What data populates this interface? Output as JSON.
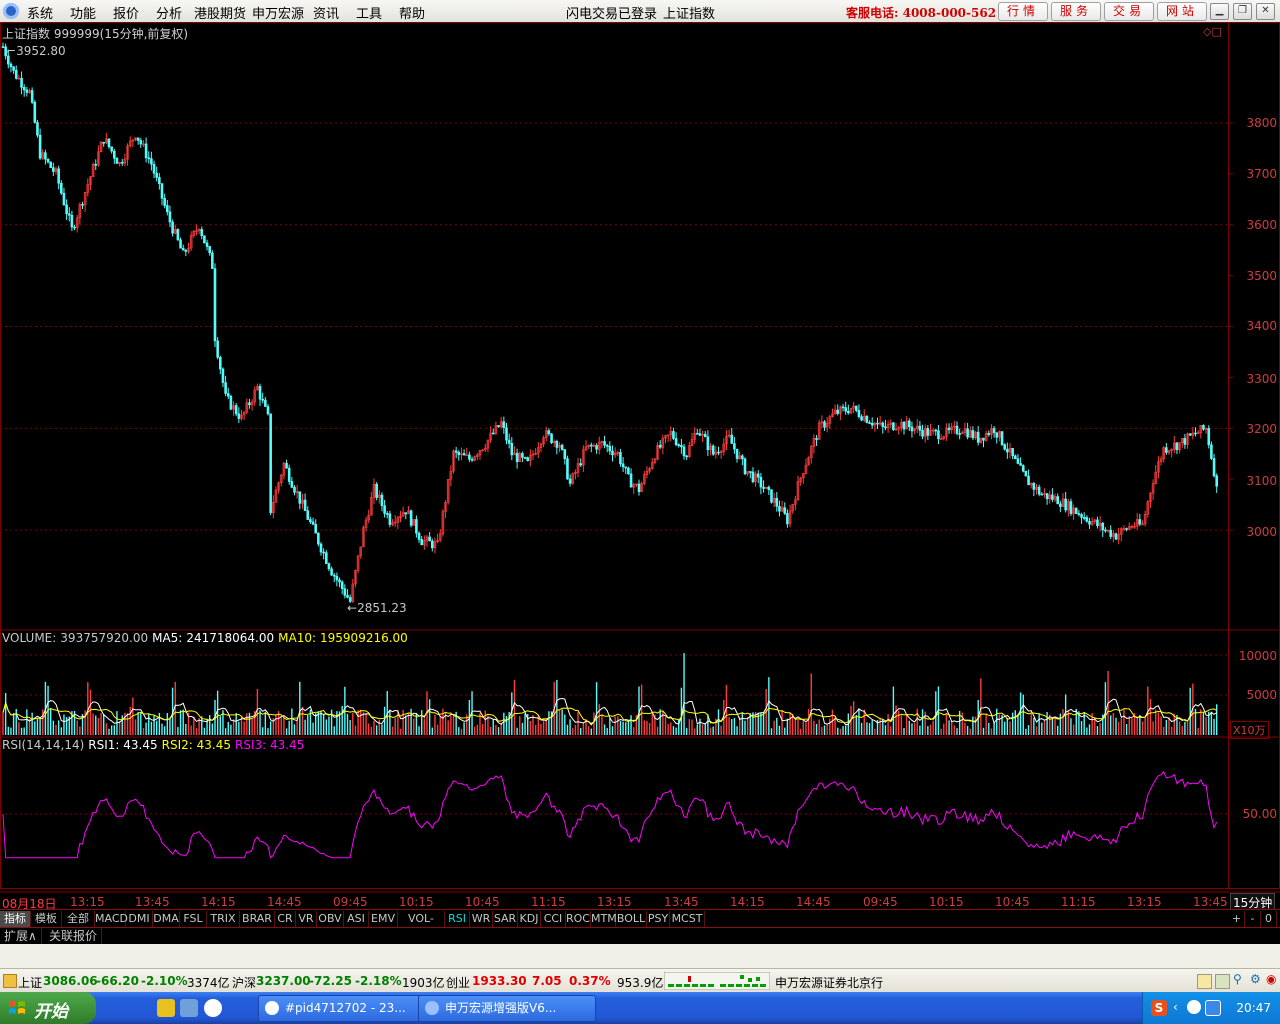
{
  "menubar": {
    "items": [
      "系统",
      "功能",
      "报价",
      "分析",
      "港股期货",
      "申万宏源",
      "资讯",
      "工具",
      "帮助"
    ],
    "status_login": "闪电交易已登录",
    "status_symbol": "上证指数",
    "hotline": "客服电话: 4008-000-562",
    "quick_buttons": [
      "行情",
      "服务",
      "交易",
      "网站"
    ]
  },
  "chart": {
    "title": "上证指数 999999(15分钟,前复权)",
    "high_label": "3952.80",
    "low_label": "2851.23",
    "price_axis": [
      "3800",
      "3700",
      "3600",
      "3500",
      "3400",
      "3300",
      "3200",
      "3100",
      "3000"
    ],
    "volume_axis": [
      "10000",
      "5000"
    ],
    "volume_unit": "X10万",
    "rsi_axis": [
      "50.00"
    ],
    "time_axis": [
      "08月18日",
      "13:15",
      "13:45",
      "14:15",
      "14:45",
      "09:45",
      "10:15",
      "10:45",
      "11:15",
      "13:15",
      "13:45",
      "14:15",
      "14:45",
      "09:45",
      "10:15",
      "10:45",
      "11:15",
      "13:15",
      "13:45"
    ],
    "period": "15分钟",
    "colors": {
      "up": "#ff3c3c",
      "down": "#54fcfc",
      "grid": "#800000",
      "ma5": "#ffffff",
      "ma10": "#ffff00",
      "rsi": "#ff00ff"
    }
  },
  "volume_header": {
    "label": "VOLUME:",
    "value": "393757920.00",
    "ma5_label": "MA5:",
    "ma5_value": "241718064.00",
    "ma10_label": "MA10:",
    "ma10_value": "195909216.00"
  },
  "rsi_header": {
    "label": "RSI(14,14,14)",
    "rsi1": "RSI1: 43.45",
    "rsi2": "RSI2: 43.45",
    "rsi3": "RSI3: 43.45"
  },
  "tabs": [
    "指标",
    "模板",
    "全部",
    "MACD",
    "DMI",
    "DMA",
    "FSL",
    "TRIX",
    "BRAR",
    "CR",
    "VR",
    "OBV",
    "ASI",
    "EMV",
    "VOL-TDX",
    "RSI",
    "WR",
    "SAR",
    "KDJ",
    "CCI",
    "ROC",
    "MTM",
    "BOLL",
    "PSY",
    "MCST"
  ],
  "active_tab": "RSI",
  "zoom_buttons": [
    "+",
    "-",
    "0"
  ],
  "subtabs": [
    "扩展∧",
    "关联报价"
  ],
  "statusbar": {
    "sh_label": "上证",
    "sh_value": "3086.06",
    "sh_change": "-66.20",
    "sh_pct": "-2.10%",
    "sh_amount": "3374亿",
    "hs_label": "沪深",
    "hs_value": "3237.00",
    "hs_change": "-72.25",
    "hs_pct": "-2.18%",
    "hs_amount": "1903亿",
    "cy_label": "创业",
    "cy_value": "1933.30",
    "cy_change": "7.05",
    "cy_pct": "0.37%",
    "cy_amount": "953.9亿",
    "broker": "申万宏源证券北京行"
  },
  "taskbar": {
    "start": "开始",
    "tasks": [
      "#pid4712702 - 23...",
      "申万宏源增强版V6..."
    ],
    "clock": "20:47"
  }
}
